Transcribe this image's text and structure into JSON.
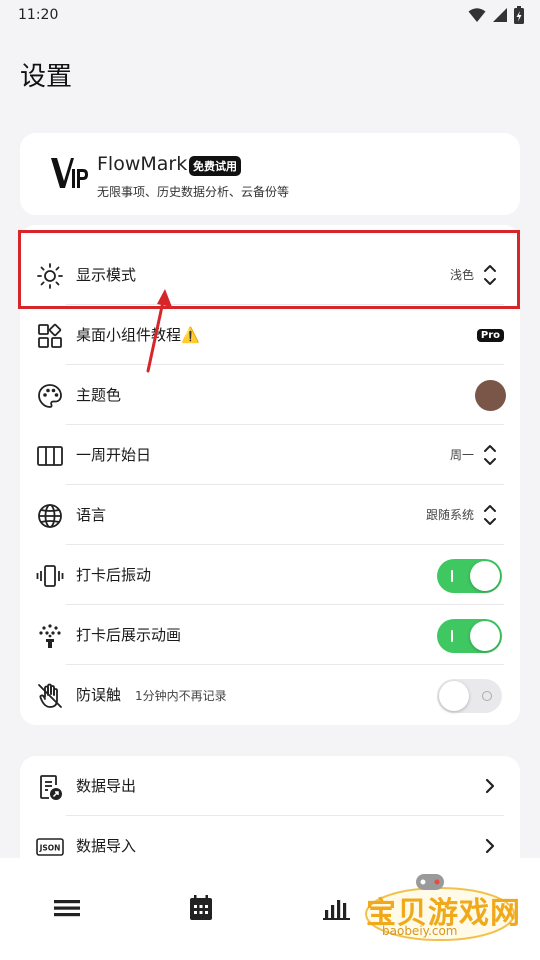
{
  "status_bar": {
    "time": "11:20",
    "icons": [
      "wifi-icon",
      "signal-icon",
      "battery-charging-icon"
    ]
  },
  "page": {
    "title": "设置"
  },
  "vip": {
    "name": "FlowMark",
    "badge": "免费试用",
    "description": "无限事项、历史数据分析、云备份等",
    "logo_icon": "vip-logo-icon"
  },
  "settings": {
    "display_mode": {
      "label": "显示模式",
      "value": "浅色",
      "icon": "sun-icon"
    },
    "widget_tutorial": {
      "label": "桌面小组件教程⚠️",
      "badge": "Pro",
      "icon": "widgets-icon"
    },
    "theme_color": {
      "label": "主题色",
      "color": "#7a5648",
      "icon": "palette-icon"
    },
    "week_start": {
      "label": "一周开始日",
      "value": "周一",
      "icon": "columns-icon"
    },
    "language": {
      "label": "语言",
      "value": "跟随系统",
      "icon": "globe-icon"
    },
    "vibration": {
      "label": "打卡后振动",
      "enabled": true,
      "icon": "vibrate-icon"
    },
    "animation": {
      "label": "打卡后展示动画",
      "enabled": true,
      "icon": "celebration-icon"
    },
    "anti_mistouch": {
      "label": "防误触",
      "sublabel": "1分钟内不再记录",
      "enabled": false,
      "icon": "hand-off-icon"
    }
  },
  "data": {
    "export": {
      "label": "数据导出",
      "icon": "export-doc-icon"
    },
    "import": {
      "label": "数据导入",
      "icon": "json-icon",
      "icon_text": "JSON"
    }
  },
  "bottom_nav": {
    "items": [
      "list-icon",
      "calendar-icon",
      "bar-chart-icon",
      "settings-icon"
    ]
  },
  "colors": {
    "toggle_on": "#3fc761",
    "highlight": "#d7262a",
    "accent_dark": "#111111"
  },
  "watermark": {
    "text": "宝贝游戏网",
    "url": "baobeiy.com"
  }
}
